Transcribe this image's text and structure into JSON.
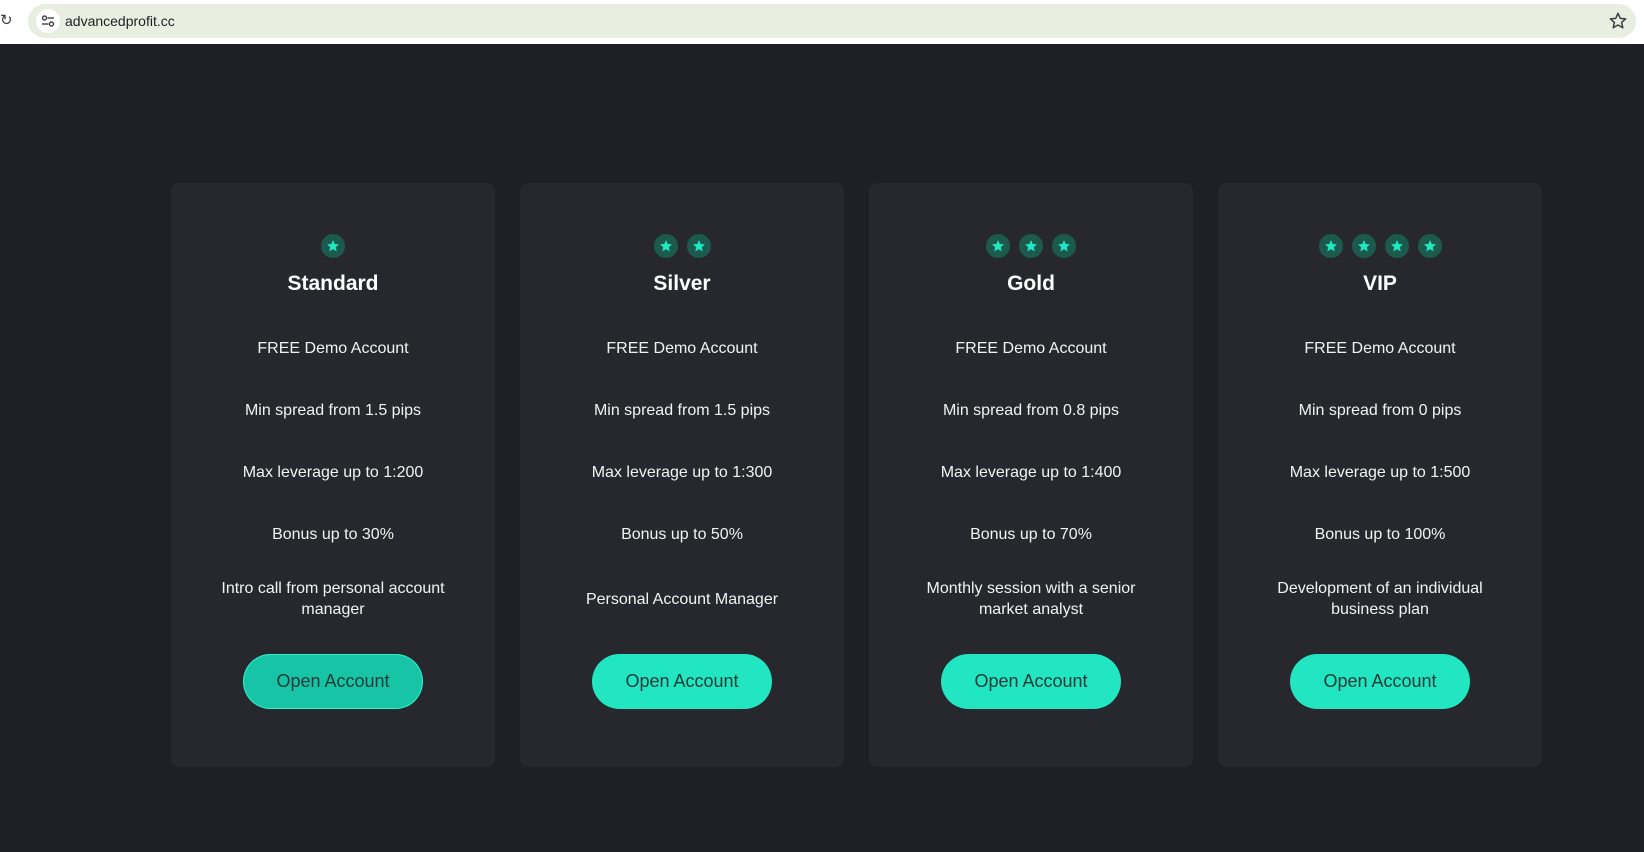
{
  "browser": {
    "url": "advancedprofit.cc"
  },
  "colors": {
    "accent": "#21e6c1",
    "accent_pressed": "#17c4a5",
    "card_bg": "#27282d",
    "page_bg": "#1f2026",
    "star_bg": "#1d5a4e"
  },
  "plans": [
    {
      "name": "Standard",
      "stars": 1,
      "features": [
        "FREE Demo Account",
        "Min spread from 1.5 pips",
        "Max leverage up to 1:200",
        "Bonus up to 30%",
        "Intro call from personal account manager"
      ],
      "button_label": "Open Account"
    },
    {
      "name": "Silver",
      "stars": 2,
      "features": [
        "FREE Demo Account",
        "Min spread from 1.5 pips",
        "Max leverage up to 1:300",
        "Bonus up to 50%",
        "Personal Account Manager"
      ],
      "button_label": "Open Account"
    },
    {
      "name": "Gold",
      "stars": 3,
      "features": [
        "FREE Demo Account",
        "Min spread from 0.8 pips",
        "Max leverage up to 1:400",
        "Bonus up to 70%",
        "Monthly session with a senior market analyst"
      ],
      "button_label": "Open Account"
    },
    {
      "name": "VIP",
      "stars": 4,
      "features": [
        "FREE Demo Account",
        "Min spread from 0 pips",
        "Max leverage up to 1:500",
        "Bonus up to 100%",
        "Development of an individual business plan"
      ],
      "button_label": "Open Account"
    }
  ]
}
